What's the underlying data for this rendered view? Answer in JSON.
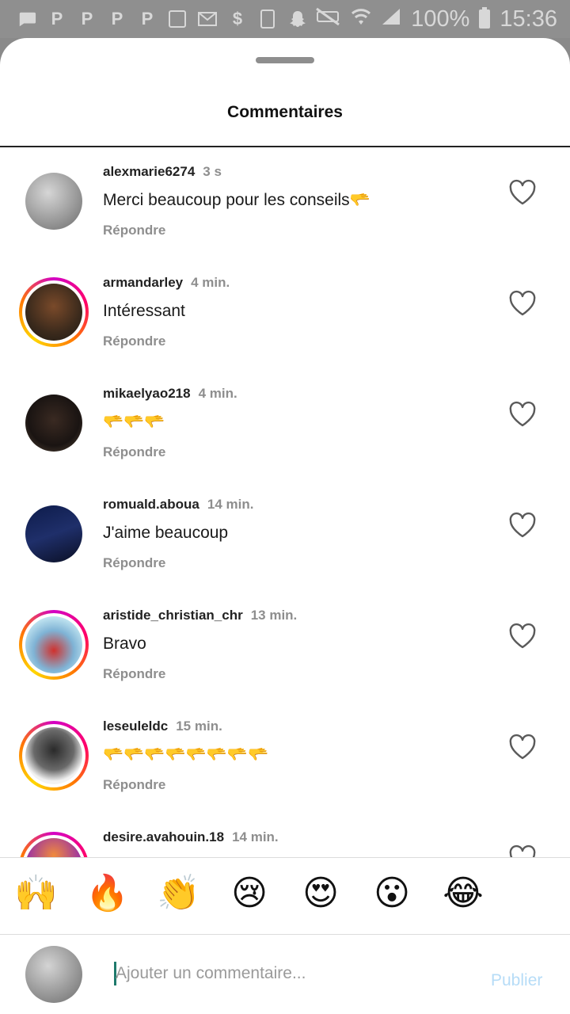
{
  "status_bar": {
    "battery_percent": "100%",
    "time": "15:36",
    "icons": [
      "message-icon",
      "parking-icon",
      "parking-icon",
      "parking-icon",
      "parking-icon",
      "image-icon",
      "mail-icon",
      "dollar-icon",
      "battery-100-icon",
      "snapchat-icon",
      "mute-icon",
      "wifi-icon",
      "signal-icon",
      "battery-icon"
    ]
  },
  "sheet": {
    "title": "Commentaires"
  },
  "comments": [
    {
      "username": "alexmarie6274",
      "time": "3 s",
      "text": "Merci beaucoup pour les conseils🫳",
      "reply": "Répondre"
    },
    {
      "username": "armandarley",
      "time": "4 min.",
      "text": "Intéressant",
      "reply": "Répondre"
    },
    {
      "username": "mikaelyao218",
      "time": "4 min.",
      "text": "🫳🫳🫳",
      "reply": "Répondre"
    },
    {
      "username": "romuald.aboua",
      "time": "14 min.",
      "text": "J'aime beaucoup",
      "reply": "Répondre"
    },
    {
      "username": "aristide_christian_chr",
      "time": "13 min.",
      "text": "Bravo",
      "reply": "Répondre"
    },
    {
      "username": "leseuleldc",
      "time": "15 min.",
      "text": "🫳🫳🫳🫳🫳🫳🫳🫳",
      "reply": "Répondre"
    },
    {
      "username": "desire.avahouin.18",
      "time": "14 min.",
      "text": "",
      "reply": ""
    }
  ],
  "emoji_bar": [
    "🙌",
    "🔥",
    "👏",
    "😢",
    "😍",
    "😮",
    "😂"
  ],
  "composer": {
    "placeholder": "Ajouter un commentaire...",
    "publish_label": "Publier"
  },
  "colors": {
    "story_ring": [
      "#d300c5",
      "#ff0069",
      "#ff7a00",
      "#ffd600"
    ],
    "publish_disabled": "#b6dcf7",
    "secondary_text": "#8e8e8e"
  }
}
